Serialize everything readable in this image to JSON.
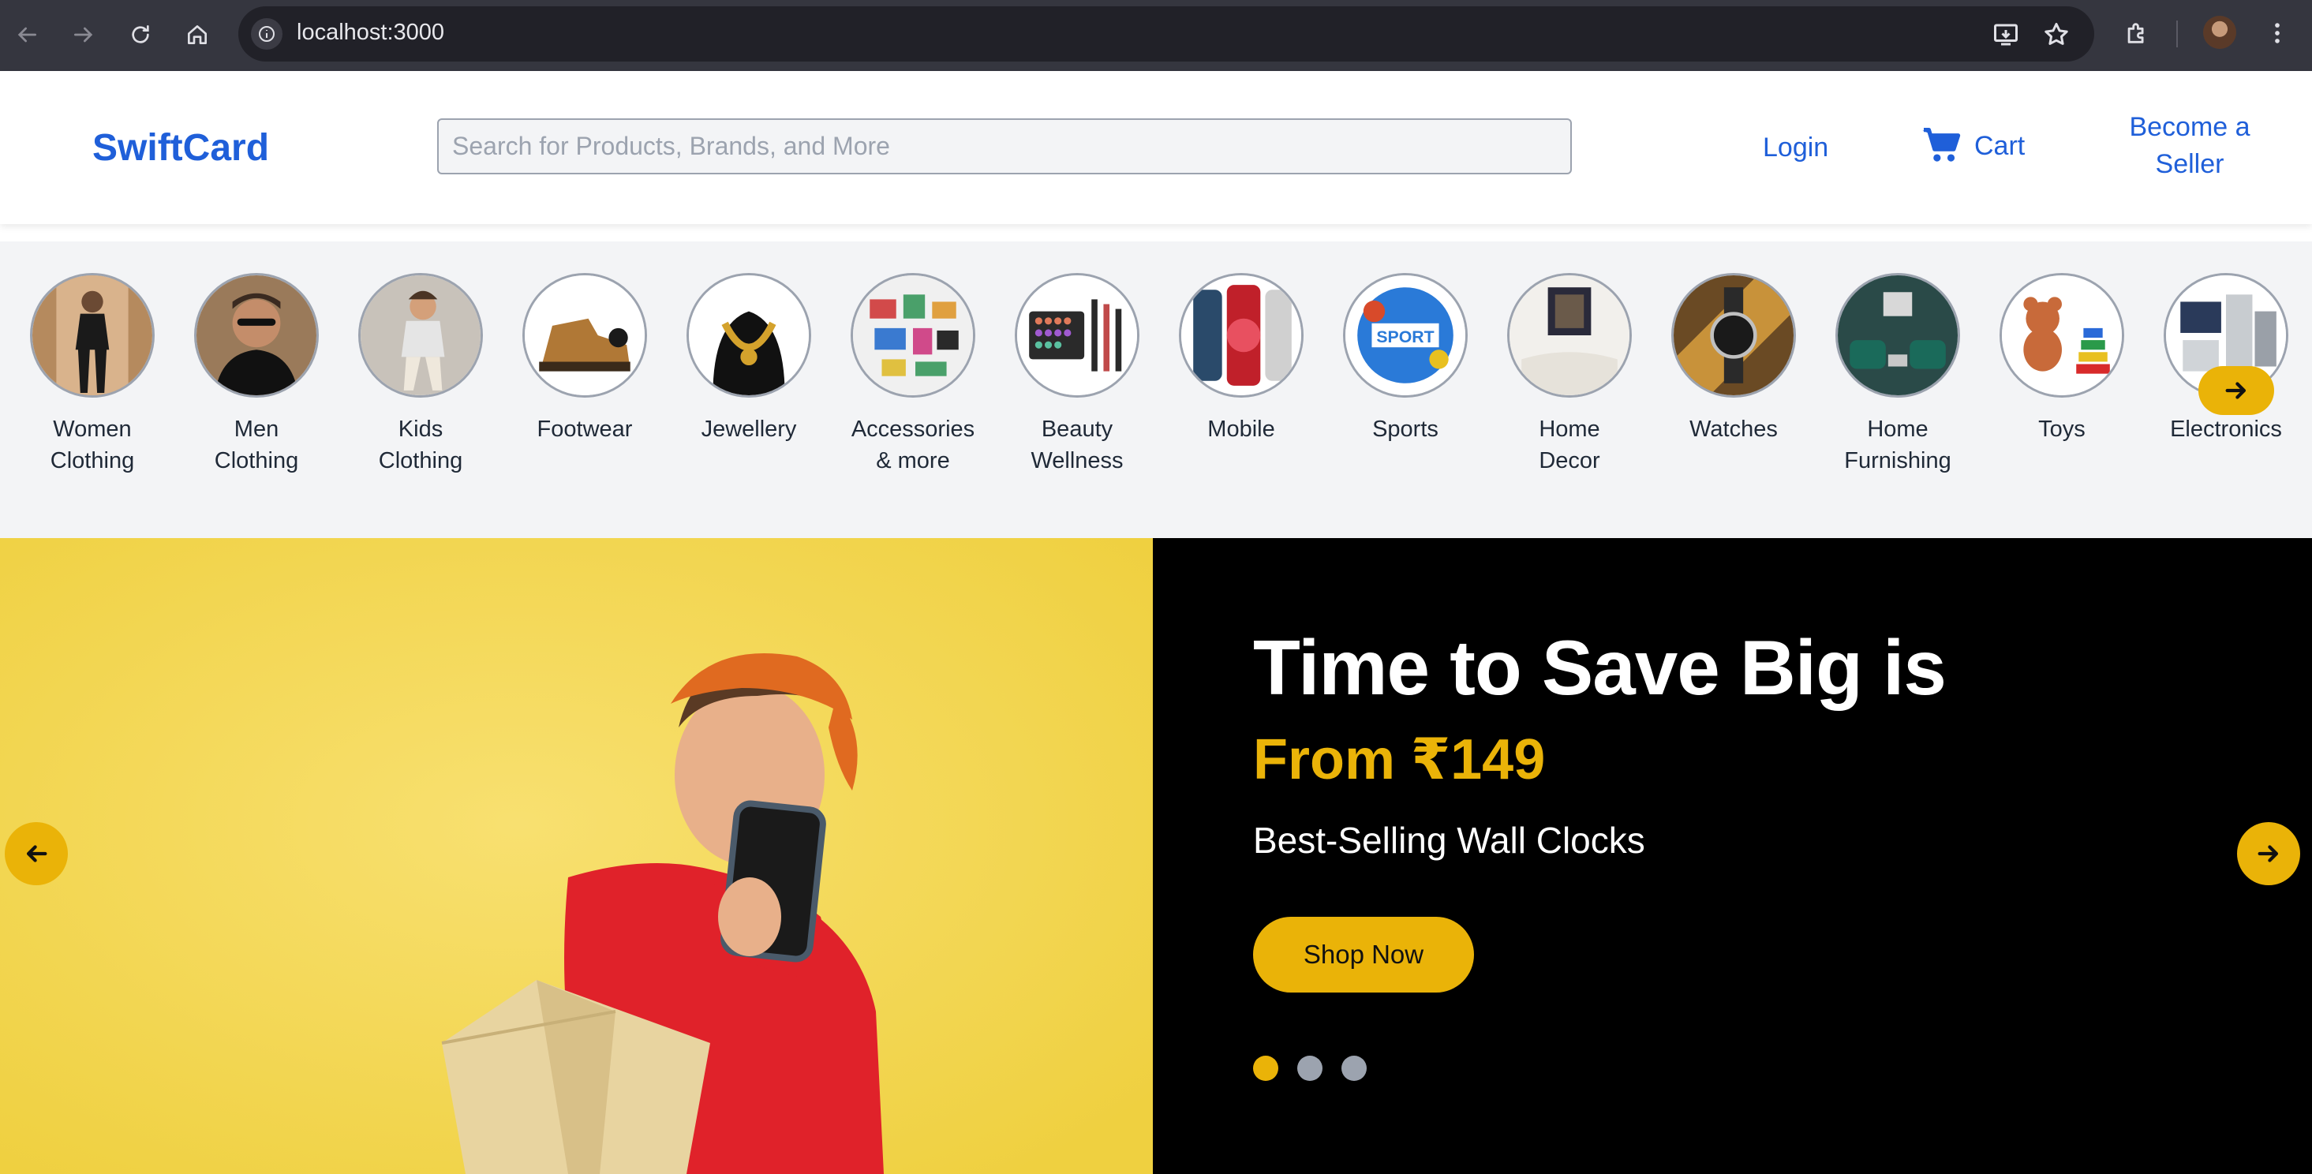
{
  "browser": {
    "url": "localhost:3000"
  },
  "header": {
    "logo": "SwiftCard",
    "search_placeholder": "Search for Products, Brands, and More",
    "login": "Login",
    "cart": "Cart",
    "seller_line1": "Become a",
    "seller_line2": "Seller"
  },
  "categories": [
    {
      "line1": "Women",
      "line2": "Clothing",
      "icon": "woman-photo"
    },
    {
      "line1": "Men",
      "line2": "Clothing",
      "icon": "man-photo"
    },
    {
      "line1": "Kids",
      "line2": "Clothing",
      "icon": "kid-photo"
    },
    {
      "line1": "Footwear",
      "line2": "",
      "icon": "boot-photo"
    },
    {
      "line1": "Jewellery",
      "line2": "",
      "icon": "necklace-photo"
    },
    {
      "line1": "Accessories",
      "line2": "& more",
      "icon": "accessories-photo"
    },
    {
      "line1": "Beauty",
      "line2": "Wellness",
      "icon": "makeup-photo"
    },
    {
      "line1": "Mobile",
      "line2": "",
      "icon": "phone-photo"
    },
    {
      "line1": "Sports",
      "line2": "",
      "icon": "sport-photo"
    },
    {
      "line1": "Home",
      "line2": "Decor",
      "icon": "decor-photo"
    },
    {
      "line1": "Watches",
      "line2": "",
      "icon": "watch-photo"
    },
    {
      "line1": "Home",
      "line2": "Furnishing",
      "icon": "sofa-photo"
    },
    {
      "line1": "Toys",
      "line2": "",
      "icon": "teddy-photo"
    },
    {
      "line1": "Electronics",
      "line2": "",
      "icon": "appliances-photo"
    }
  ],
  "sport_logo_text": "SPORT",
  "hero": {
    "title": "Time to Save Big is",
    "price": "From ₹149",
    "subtitle": "Best-Selling Wall Clocks",
    "cta": "Shop Now",
    "slide_count": 3,
    "active_slide": 1
  },
  "colors": {
    "brand_blue": "#1f5fd9",
    "accent_yellow": "#eab308",
    "hero_bg_left": "#f4d94a",
    "hero_bg_right": "#000000"
  }
}
